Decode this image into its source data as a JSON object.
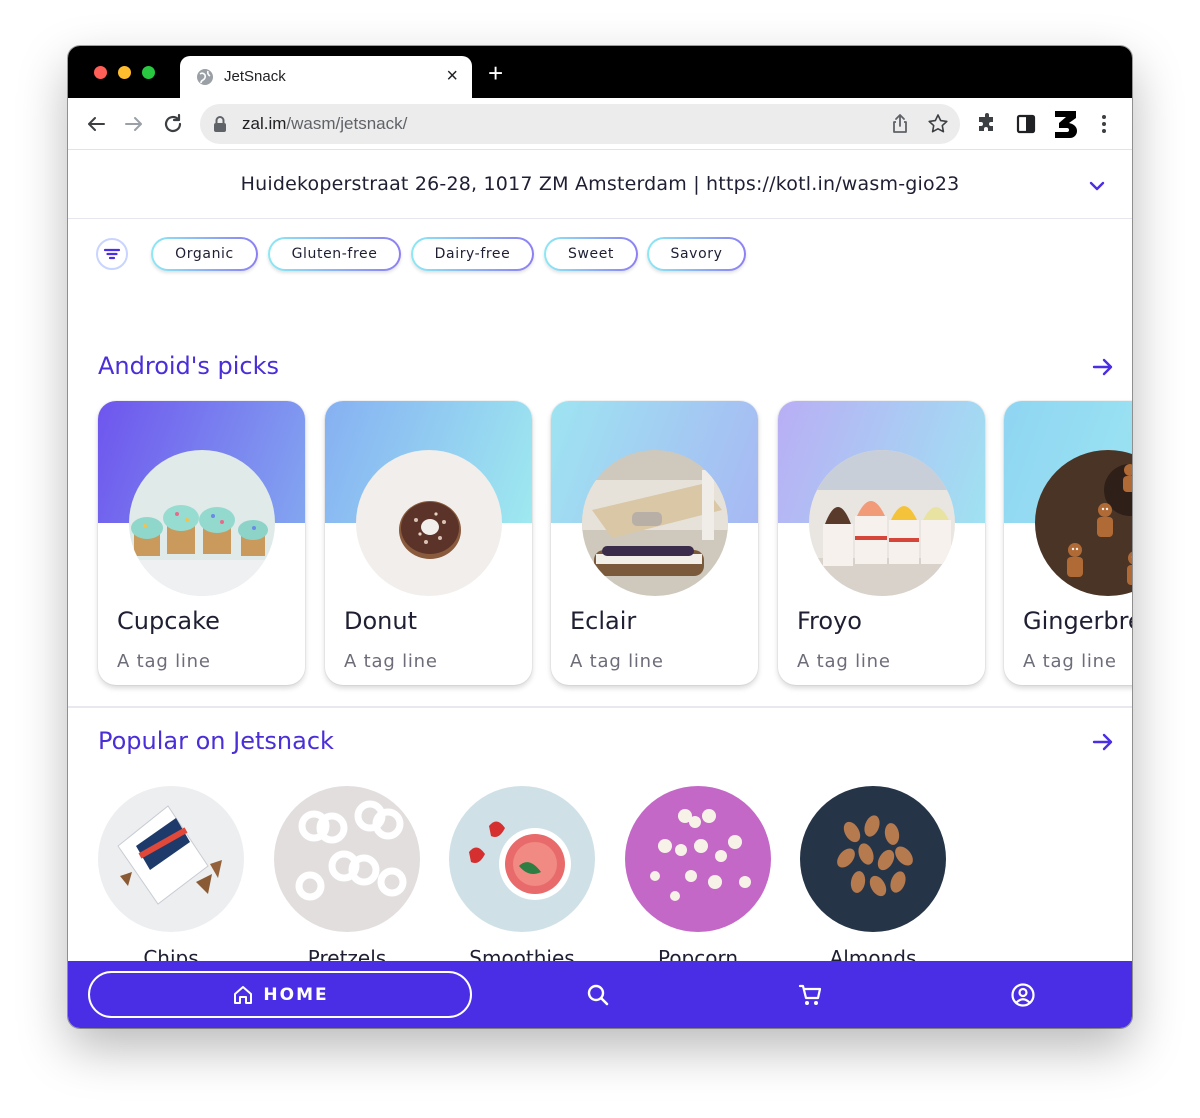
{
  "browser": {
    "tab_title": "JetSnack",
    "tab_close": "×",
    "new_tab": "+",
    "url_host": "zal.im",
    "url_path": "/wasm/jetsnack/"
  },
  "app": {
    "address": "Huidekoperstraat 26-28, 1017 ZM Amsterdam | https://kotl.in/wasm-gio23",
    "filters": [
      "Organic",
      "Gluten-free",
      "Dairy-free",
      "Sweet",
      "Savory"
    ],
    "picks": {
      "title": "Android's picks",
      "cards": [
        {
          "name": "Cupcake",
          "tagline": "A tag line"
        },
        {
          "name": "Donut",
          "tagline": "A tag line"
        },
        {
          "name": "Eclair",
          "tagline": "A tag line"
        },
        {
          "name": "Froyo",
          "tagline": "A tag line"
        },
        {
          "name": "Gingerbread",
          "tagline": "A tag line"
        }
      ]
    },
    "popular": {
      "title": "Popular on Jetsnack",
      "items": [
        {
          "name": "Chips"
        },
        {
          "name": "Pretzels"
        },
        {
          "name": "Smoothies"
        },
        {
          "name": "Popcorn"
        },
        {
          "name": "Almonds"
        }
      ]
    },
    "bottom_nav": {
      "home_label": "HOME",
      "icons": [
        "home-icon",
        "search-icon",
        "cart-icon",
        "account-icon"
      ]
    }
  },
  "colors": {
    "accent": "#4a2ee5",
    "title": "#4a2ed8"
  }
}
